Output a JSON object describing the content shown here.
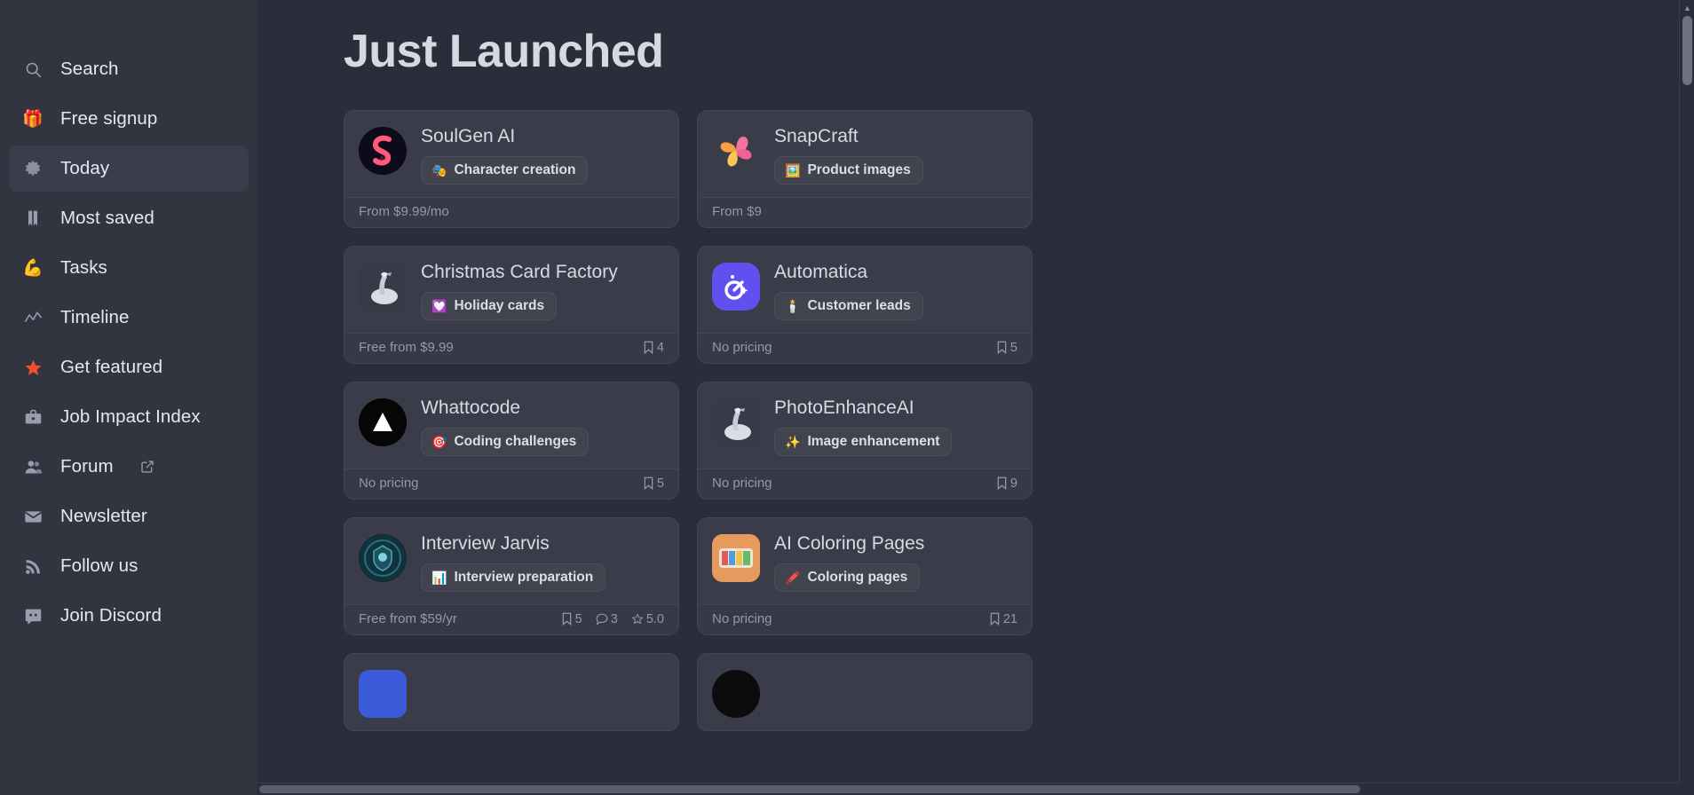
{
  "sidebar": {
    "items": [
      {
        "label": "Search",
        "icon": "search-icon",
        "active": false,
        "external": false
      },
      {
        "label": "Free signup",
        "icon": "gift-icon",
        "active": false,
        "external": false
      },
      {
        "label": "Today",
        "icon": "sparkle-icon",
        "active": true,
        "external": false
      },
      {
        "label": "Most saved",
        "icon": "bookmark-icon",
        "active": false,
        "external": false
      },
      {
        "label": "Tasks",
        "icon": "muscle-icon",
        "active": false,
        "external": false
      },
      {
        "label": "Timeline",
        "icon": "trendline-icon",
        "active": false,
        "external": false
      },
      {
        "label": "Get featured",
        "icon": "star-icon",
        "active": false,
        "external": false
      },
      {
        "label": "Job Impact Index",
        "icon": "briefcase-icon",
        "active": false,
        "external": false
      },
      {
        "label": "Forum",
        "icon": "people-icon",
        "active": false,
        "external": true
      },
      {
        "label": "Newsletter",
        "icon": "envelope-icon",
        "active": false,
        "external": false
      },
      {
        "label": "Follow us",
        "icon": "rss-icon",
        "active": false,
        "external": false
      },
      {
        "label": "Join Discord",
        "icon": "discord-icon",
        "active": false,
        "external": false
      }
    ]
  },
  "main": {
    "title": "Just Launched",
    "cards": [
      {
        "name": "SoulGen AI",
        "tag": "Character creation",
        "tag_emoji": "🎭",
        "price": "From $9.99/mo",
        "saves": "",
        "comments": "",
        "rating": "",
        "logo_class": "lg-soulgen",
        "logo_glyph": "S"
      },
      {
        "name": "SnapCraft",
        "tag": "Product images",
        "tag_emoji": "🖼️",
        "price": "From $9",
        "saves": "",
        "comments": "",
        "rating": "",
        "logo_class": "lg-snap",
        "logo_glyph": ""
      },
      {
        "name": "Christmas Card Factory",
        "tag": "Holiday cards",
        "tag_emoji": "💟",
        "price": "Free from $9.99",
        "saves": "4",
        "comments": "",
        "rating": "",
        "logo_class": "lg-xmas",
        "logo_glyph": "🦢"
      },
      {
        "name": "Automatica",
        "tag": "Customer leads",
        "tag_emoji": "🕯️",
        "price": "No pricing",
        "saves": "5",
        "comments": "",
        "rating": "",
        "logo_class": "lg-auto",
        "logo_glyph": "ȯ"
      },
      {
        "name": "Whattocode",
        "tag": "Coding challenges",
        "tag_emoji": "🎯",
        "price": "No pricing",
        "saves": "5",
        "comments": "",
        "rating": "",
        "logo_class": "lg-what",
        "logo_glyph": "▲"
      },
      {
        "name": "PhotoEnhanceAI",
        "tag": "Image enhancement",
        "tag_emoji": "✨",
        "price": "No pricing",
        "saves": "9",
        "comments": "",
        "rating": "",
        "logo_class": "lg-photo",
        "logo_glyph": "🦢"
      },
      {
        "name": "Interview Jarvis",
        "tag": "Interview preparation",
        "tag_emoji": "📊",
        "price": "Free from $59/yr",
        "saves": "5",
        "comments": "3",
        "rating": "5.0",
        "logo_class": "lg-jarvis",
        "logo_glyph": "🛡"
      },
      {
        "name": "AI Coloring Pages",
        "tag": "Coloring pages",
        "tag_emoji": "🖍️",
        "price": "No pricing",
        "saves": "21",
        "comments": "",
        "rating": "",
        "logo_class": "lg-color",
        "logo_glyph": "🎨"
      },
      {
        "name": "",
        "tag": "",
        "tag_emoji": "",
        "price": "",
        "saves": "",
        "comments": "",
        "rating": "",
        "logo_class": "lg-blue",
        "logo_glyph": ""
      },
      {
        "name": "",
        "tag": "",
        "tag_emoji": "",
        "price": "",
        "saves": "",
        "comments": "",
        "rating": "",
        "logo_class": "lg-dark",
        "logo_glyph": ""
      }
    ]
  },
  "scrollbars": {
    "up_arrow": "▲",
    "down_arrow": "▼"
  },
  "colors": {
    "bg": "#2b2d3a",
    "sidebar": "#32343f",
    "card": "#3a3c49",
    "accent_star": "#f0502a",
    "accent_gift": "#4ade4a"
  }
}
